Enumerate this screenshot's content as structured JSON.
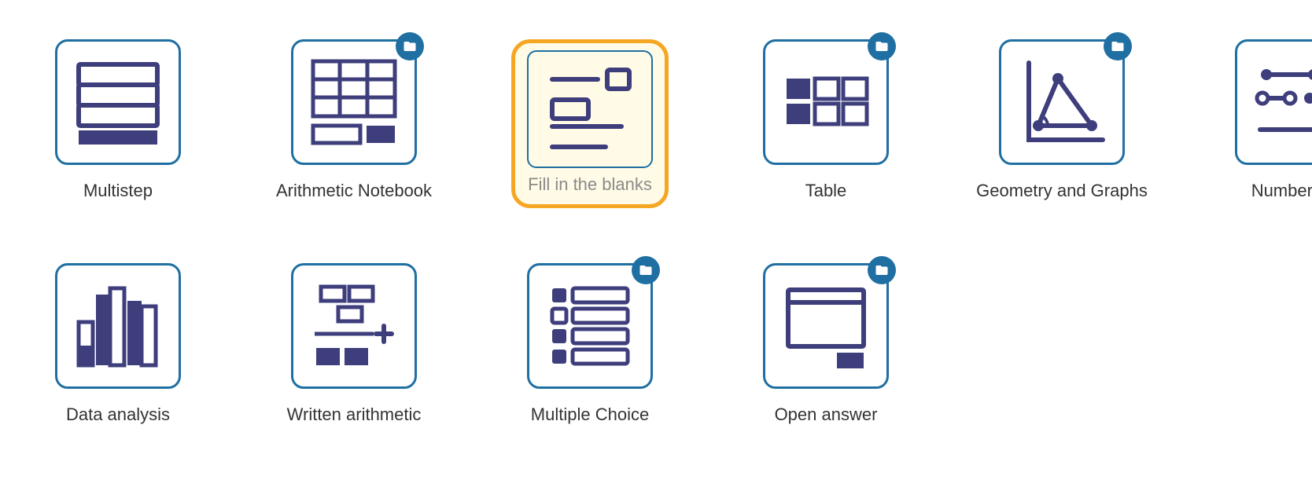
{
  "colors": {
    "border": "#1f6fa2",
    "icon_fill": "#3e3e7c",
    "selected_border": "#f5a623",
    "selected_bg": "#fffbe6",
    "label": "#333333",
    "selected_label": "#8a8a8a"
  },
  "tiles": [
    {
      "id": "multistep",
      "label": "Multistep",
      "has_folder": false,
      "selected": false,
      "icon": "multistep-icon"
    },
    {
      "id": "arithmetic-notebook",
      "label": "Arithmetic Notebook",
      "has_folder": true,
      "selected": false,
      "icon": "arithmetic-notebook-icon"
    },
    {
      "id": "fill-blanks",
      "label": "Fill in the blanks",
      "has_folder": false,
      "selected": true,
      "icon": "fill-blanks-icon"
    },
    {
      "id": "table",
      "label": "Table",
      "has_folder": true,
      "selected": false,
      "icon": "table-icon"
    },
    {
      "id": "geometry-graphs",
      "label": "Geometry and Graphs",
      "has_folder": true,
      "selected": false,
      "icon": "geometry-graphs-icon"
    },
    {
      "id": "number-line",
      "label": "Number line",
      "has_folder": false,
      "selected": false,
      "icon": "number-line-icon"
    },
    {
      "id": "data-analysis",
      "label": "Data analysis",
      "has_folder": false,
      "selected": false,
      "icon": "data-analysis-icon"
    },
    {
      "id": "written-arithmetic",
      "label": "Written arithmetic",
      "has_folder": false,
      "selected": false,
      "icon": "written-arithmetic-icon"
    },
    {
      "id": "multiple-choice",
      "label": "Multiple Choice",
      "has_folder": true,
      "selected": false,
      "icon": "multiple-choice-icon"
    },
    {
      "id": "open-answer",
      "label": "Open answer",
      "has_folder": true,
      "selected": false,
      "icon": "open-answer-icon"
    }
  ]
}
